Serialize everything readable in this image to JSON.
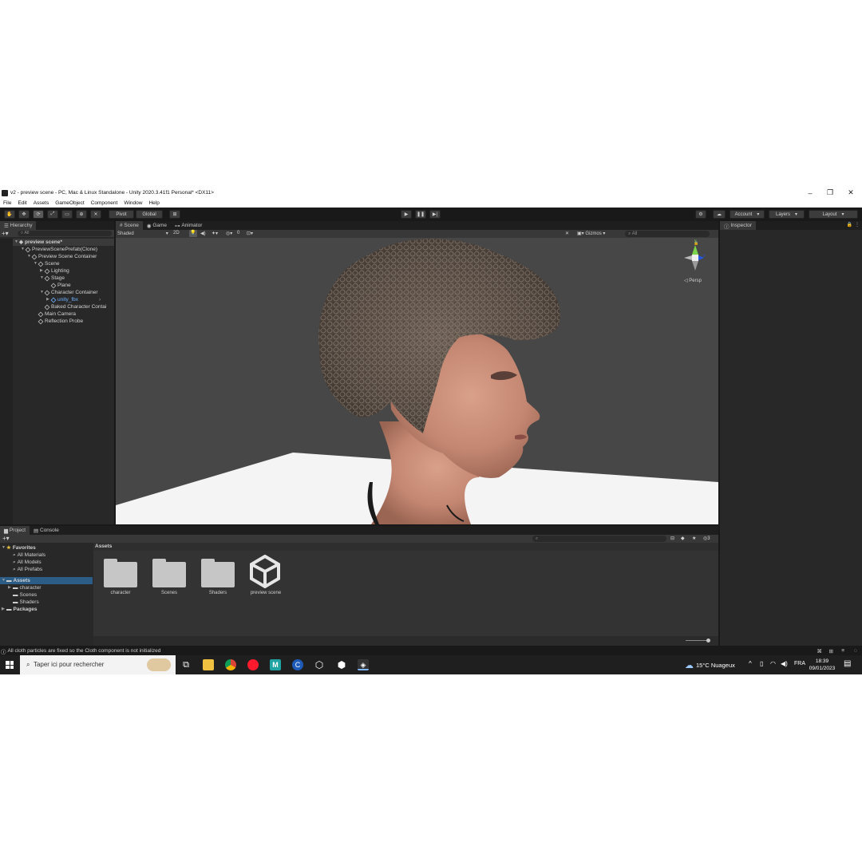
{
  "window": {
    "title": "v2 - preview scene - PC, Mac & Linux Standalone - Unity 2020.3.41f1 Personal* <DX11>",
    "controls": [
      "–",
      "❐",
      "✕"
    ]
  },
  "menu": [
    "File",
    "Edit",
    "Assets",
    "GameObject",
    "Component",
    "Window",
    "Help"
  ],
  "toolbar": {
    "pivot": "Pivot",
    "global": "Global",
    "account": "Account",
    "layers": "Layers",
    "layout": "Layout"
  },
  "hierarchy": {
    "tab": "Hierarchy",
    "search_placeholder": "All",
    "scene_name": "preview scene*",
    "items": [
      {
        "label": "PreviewScenePrefab(Clone)",
        "depth": 1
      },
      {
        "label": "Preview Scene Container",
        "depth": 2
      },
      {
        "label": "Scene",
        "depth": 3
      },
      {
        "label": "Lighting",
        "depth": 4
      },
      {
        "label": "Stage",
        "depth": 4
      },
      {
        "label": "Plane",
        "depth": 5
      },
      {
        "label": "Character Container",
        "depth": 4
      },
      {
        "label": "unity_fbx",
        "depth": 5
      },
      {
        "label": "Baked Character Contai",
        "depth": 4
      },
      {
        "label": "Main Camera",
        "depth": 3
      },
      {
        "label": "Reflection Probe",
        "depth": 3
      }
    ]
  },
  "scene": {
    "tabs": [
      "Scene",
      "Game",
      "Animator"
    ],
    "shading": "Shaded",
    "mode_2d": "2D",
    "hidden_count": "0",
    "gizmos": "Gizmos",
    "search_placeholder": "All",
    "persp_label": "Persp",
    "axis_y": "y",
    "axis_z": "z"
  },
  "inspector": {
    "tab": "Inspector"
  },
  "project": {
    "tabs": [
      "Project",
      "Console"
    ],
    "favorites_label": "Favorites",
    "favorites": [
      "All Materials",
      "All Models",
      "All Prefabs"
    ],
    "assets_label": "Assets",
    "assets_children": [
      "character",
      "Scenes",
      "Shaders"
    ],
    "packages_label": "Packages",
    "breadcrumb": "Assets",
    "hidden_count": "3",
    "items": [
      "character",
      "Scenes",
      "Shaders",
      "preview scene"
    ]
  },
  "status": {
    "message": "All cloth particles are fixed so the Cloth component is not initialized"
  },
  "taskbar": {
    "search_placeholder": "Taper ici pour rechercher",
    "weather": "15°C Nuageux",
    "lang": "FRA",
    "time": "18:39",
    "date": "09/01/2023"
  },
  "colors": {
    "editor_bg": "#282828",
    "viewport_bg": "#474747",
    "accent_blue": "#4aa3ff",
    "gizmo_green": "#7bd34b",
    "gizmo_blue": "#2456e0",
    "gizmo_red": "#e04a3a"
  }
}
